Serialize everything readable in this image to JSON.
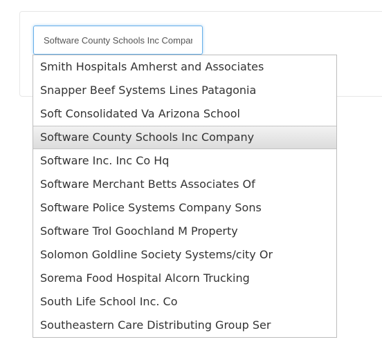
{
  "search": {
    "value": "Software County Schools Inc Company"
  },
  "dropdown": {
    "selected_index": 3,
    "items": [
      "Smith Hospitals Amherst and Associates",
      "Snapper Beef Systems Lines Patagonia",
      "Soft Consolidated Va Arizona School",
      "Software County Schools Inc Company",
      "Software Inc. Inc Co Hq",
      "Software Merchant Betts Associates Of",
      "Software Police Systems Company Sons",
      "Software Trol Goochland M Property",
      "Solomon Goldline Society Systems/city Or",
      "Sorema Food Hospital Alcorn Trucking",
      "South Life School Inc. Co",
      "Southeastern Care Distributing Group Ser"
    ]
  },
  "colors": {
    "focus_border": "#66afe9",
    "highlight_bg": "#e6e6e6",
    "text": "#333333"
  }
}
